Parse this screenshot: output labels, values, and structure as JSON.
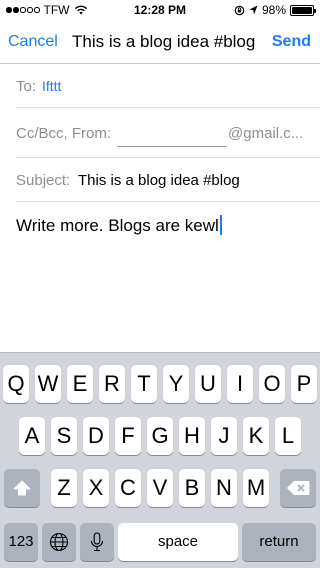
{
  "status_bar": {
    "carrier": "TFW",
    "signal_bars_filled": 2,
    "signal_bars_total": 5,
    "time": "12:28 PM",
    "battery_percent": "98%",
    "battery_level": 0.98
  },
  "nav": {
    "cancel_label": "Cancel",
    "title": "This is a blog idea #blog",
    "send_label": "Send"
  },
  "fields": {
    "to_label": "To:",
    "to_value": "Ifttt",
    "cc_label": "Cc/Bcc, From:",
    "from_domain": "@gmail.c...",
    "subject_label": "Subject:",
    "subject_value": "This is a blog idea #blog"
  },
  "body": {
    "text": "Write more. Blogs are kewl"
  },
  "keyboard": {
    "row1": [
      "Q",
      "W",
      "E",
      "R",
      "T",
      "Y",
      "U",
      "I",
      "O",
      "P"
    ],
    "row2": [
      "A",
      "S",
      "D",
      "F",
      "G",
      "H",
      "J",
      "K",
      "L"
    ],
    "row3": [
      "Z",
      "X",
      "C",
      "V",
      "B",
      "N",
      "M"
    ],
    "numbers_label": "123",
    "space_label": "space",
    "return_label": "return"
  }
}
